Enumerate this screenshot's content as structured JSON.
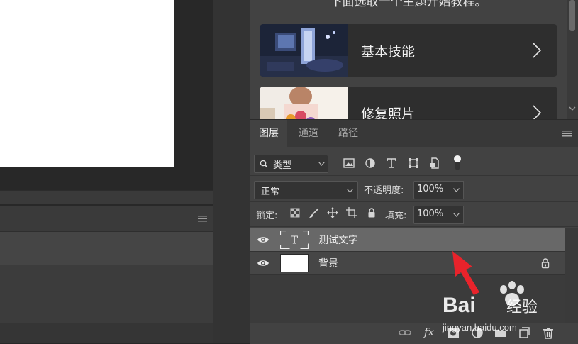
{
  "learn": {
    "title": "下面选取一个主题开始教程。",
    "tutorials": [
      {
        "label": "基本技能"
      },
      {
        "label": "修复照片"
      }
    ]
  },
  "layers": {
    "tabs": [
      "图层",
      "通道",
      "路径"
    ],
    "filter": {
      "value": "类型"
    },
    "blend_mode": {
      "value": "正常"
    },
    "opacity": {
      "label": "不透明度:",
      "value": "100%"
    },
    "lock": {
      "label": "锁定:"
    },
    "fill": {
      "label": "填充:",
      "value": "100%"
    },
    "items": [
      {
        "name": "测试文字",
        "kind": "text",
        "selected": true,
        "visible": true
      },
      {
        "name": "背景",
        "kind": "background",
        "selected": false,
        "visible": true,
        "locked": true
      }
    ],
    "bottom_bar": {
      "fx_label": "fx"
    }
  },
  "watermark": {
    "brand": "Bai",
    "brand_cn": "经验",
    "url": "jingyan.baidu.com"
  },
  "colors": {
    "selected_row": "#686868",
    "panel": "#424242",
    "arrow": "#e8232b"
  }
}
